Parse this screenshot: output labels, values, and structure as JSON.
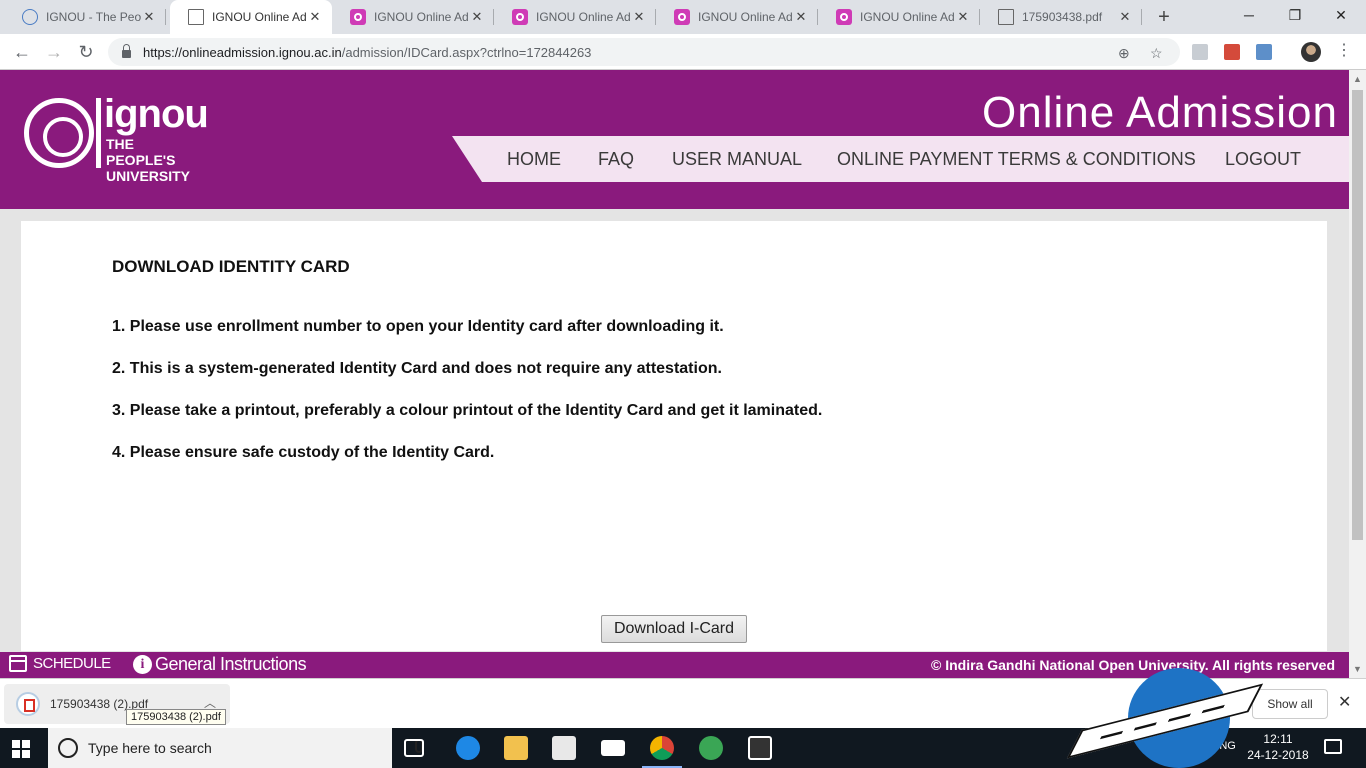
{
  "browser": {
    "tabs": [
      {
        "title": "IGNOU - The Peo",
        "favicon": "globe-icon"
      },
      {
        "title": "IGNOU Online Ad",
        "favicon": "document-icon",
        "active": true
      },
      {
        "title": "IGNOU Online Ad",
        "favicon": "ignou-favicon"
      },
      {
        "title": "IGNOU Online Ad",
        "favicon": "ignou-favicon"
      },
      {
        "title": "IGNOU Online Ad",
        "favicon": "ignou-favicon"
      },
      {
        "title": "IGNOU Online Ad",
        "favicon": "ignou-favicon"
      },
      {
        "title": "175903438.pdf",
        "favicon": "document-icon"
      }
    ],
    "close_glyph": "✕",
    "new_tab_glyph": "+",
    "url_host": "https://onlineadmission.ignou.ac.in",
    "url_path": "/admission/IDCard.aspx?ctrlno=172844263"
  },
  "site": {
    "logo_name": "ignou",
    "logo_tagline": "THE PEOPLE'S UNIVERSITY",
    "title": "Online Admission",
    "nav": [
      "HOME",
      "FAQ",
      "USER MANUAL",
      "ONLINE PAYMENT TERMS & CONDITIONS",
      "LOGOUT"
    ],
    "brand_color": "#8a1a7d"
  },
  "main": {
    "heading": "DOWNLOAD IDENTITY CARD",
    "instructions": [
      "1. Please use enrollment number to open your Identity card after downloading it.",
      "2. This is a system-generated Identity Card and does not require any attestation.",
      "3. Please take a printout, preferably a colour printout of the Identity Card and get it laminated.",
      "4. Please ensure safe custody of the Identity Card."
    ],
    "download_button": "Download I-Card"
  },
  "footer": {
    "schedule": "SCHEDULE",
    "general_instructions": "General Instructions",
    "copyright": "© Indira Gandhi National Open University. All rights reserved"
  },
  "download_shelf": {
    "file_name": "175903438 (2).pdf",
    "tooltip": "175903438 (2).pdf",
    "show_all": "Show all"
  },
  "taskbar": {
    "search_placeholder": "Type here to search",
    "language": "ENG",
    "time": "12:11",
    "date": "24-12-2018"
  }
}
